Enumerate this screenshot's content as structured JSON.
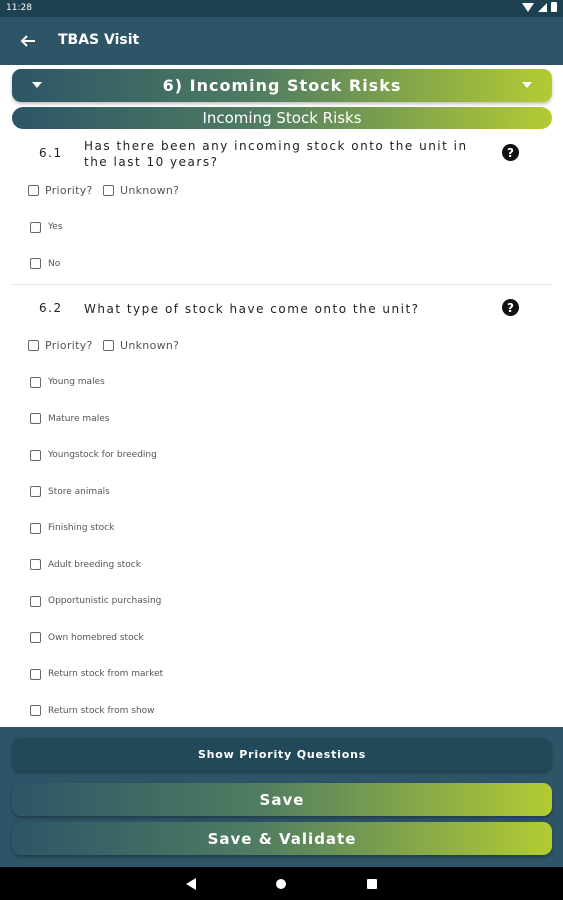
{
  "status_bar": {
    "time": "11:28"
  },
  "app_bar": {
    "back_icon": "arrow-left-icon",
    "title": "TBAS Visit"
  },
  "section": {
    "title": "6) Incoming Stock Risks",
    "subtitle": "Incoming Stock Risks"
  },
  "questions": [
    {
      "number": "6.1",
      "text": "Has there been any incoming stock onto the unit in the last 10 years?",
      "help_icon": "?",
      "flags": [
        "Priority?",
        "Unknown?"
      ],
      "options": [
        "Yes",
        "No"
      ]
    },
    {
      "number": "6.2",
      "text": "What type of stock have come onto the unit?",
      "help_icon": "?",
      "flags": [
        "Priority?",
        "Unknown?"
      ],
      "options": [
        "Young males",
        "Mature males",
        "Youngstock for breeding",
        "Store animals",
        "Finishing stock",
        "Adult breeding stock",
        "Opportunistic purchasing",
        "Own homebred stock",
        "Return stock from market",
        "Return stock from show"
      ]
    }
  ],
  "buttons": {
    "show_priority": "Show Priority Questions",
    "save": "Save",
    "save_validate": "Save & Validate"
  },
  "colors": {
    "app_bar": "#2d5567",
    "gradient_start": "#2d5567",
    "gradient_end": "#b3cc33",
    "status_bar": "#1e4152"
  }
}
